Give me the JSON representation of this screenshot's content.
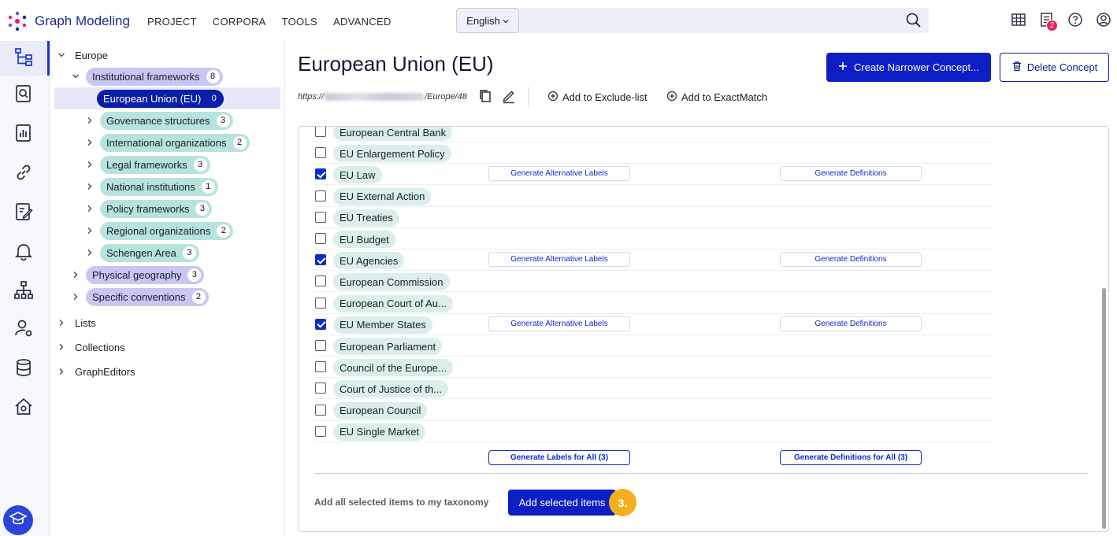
{
  "app": {
    "name": "Graph Modeling"
  },
  "topnav": [
    "PROJECT",
    "CORPORA",
    "TOOLS",
    "ADVANCED"
  ],
  "language": {
    "selected": "English"
  },
  "notifications": {
    "count": "2"
  },
  "tree": {
    "root": "Europe",
    "institutional": {
      "label": "Institutional frameworks",
      "count": "8"
    },
    "selected": {
      "label": "European Union (EU)",
      "count": "0"
    },
    "children": [
      {
        "label": "Governance structures",
        "count": "3"
      },
      {
        "label": "International organizations",
        "count": "2"
      },
      {
        "label": "Legal frameworks",
        "count": "3"
      },
      {
        "label": "National institutions",
        "count": "1"
      },
      {
        "label": "Policy frameworks",
        "count": "3"
      },
      {
        "label": "Regional organizations",
        "count": "2"
      },
      {
        "label": "Schengen Area",
        "count": "3"
      }
    ],
    "siblings": [
      {
        "label": "Physical geography",
        "count": "3"
      },
      {
        "label": "Specific conventions",
        "count": "2"
      }
    ],
    "top_level": [
      "Lists",
      "Collections",
      "GraphEditors"
    ]
  },
  "concept": {
    "title": "European Union (EU)",
    "uri_prefix": "https://",
    "uri_suffix": "/Europe/48"
  },
  "actions": {
    "create_narrower": "Create Narrower Concept...",
    "delete": "Delete Concept",
    "exclude": "Add to Exclude-list",
    "exact_match": "Add to ExactMatch"
  },
  "suggestions": {
    "items": [
      {
        "label": "European Central Bank",
        "checked": false
      },
      {
        "label": "EU Enlargement Policy",
        "checked": false
      },
      {
        "label": "EU Law",
        "checked": true
      },
      {
        "label": "EU External Action",
        "checked": false
      },
      {
        "label": "EU Treaties",
        "checked": false
      },
      {
        "label": "EU Budget",
        "checked": false
      },
      {
        "label": "EU Agencies",
        "checked": true
      },
      {
        "label": "European Commission",
        "checked": false
      },
      {
        "label": "European Court of Au...",
        "checked": false
      },
      {
        "label": "EU Member States",
        "checked": true
      },
      {
        "label": "European Parliament",
        "checked": false
      },
      {
        "label": "Council of the Europe...",
        "checked": false
      },
      {
        "label": "Court of Justice of th...",
        "checked": false
      },
      {
        "label": "European Council",
        "checked": false
      },
      {
        "label": "EU Single Market",
        "checked": false
      }
    ],
    "gen_alt_label": "Generate Alternative Labels",
    "gen_def_label": "Generate Definitions",
    "gen_labels_all": "Generate Labels for All (3)",
    "gen_defs_all": "Generate Definitions for All (3)",
    "footer_label": "Add all selected items to my taxonomy",
    "add_button": "Add selected items",
    "step": "3."
  },
  "colors": {
    "primary": "#0c1ec4",
    "brand": "#1b2a8f",
    "pill_purple": "#c9c6f2",
    "pill_teal": "#b8e2dc",
    "item_pill": "#dbeee9",
    "badge_red": "#e0245e",
    "step_yellow": "#f2b01e"
  }
}
